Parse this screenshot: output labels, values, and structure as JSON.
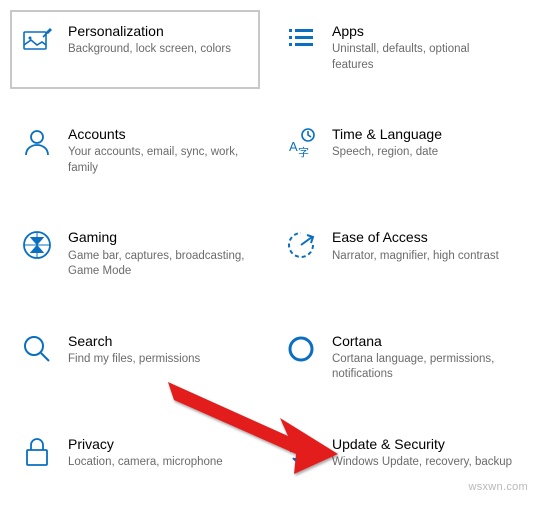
{
  "accent": "#0a6fc1",
  "arrow_color": "#e31b1b",
  "tiles": [
    {
      "id": "personalization",
      "title": "Personalization",
      "desc": "Background, lock screen, colors",
      "selected": true
    },
    {
      "id": "apps",
      "title": "Apps",
      "desc": "Uninstall, defaults, optional features",
      "selected": false
    },
    {
      "id": "accounts",
      "title": "Accounts",
      "desc": "Your accounts, email, sync, work, family",
      "selected": false
    },
    {
      "id": "time-language",
      "title": "Time & Language",
      "desc": "Speech, region, date",
      "selected": false
    },
    {
      "id": "gaming",
      "title": "Gaming",
      "desc": "Game bar, captures, broadcasting, Game Mode",
      "selected": false
    },
    {
      "id": "ease-of-access",
      "title": "Ease of Access",
      "desc": "Narrator, magnifier, high contrast",
      "selected": false
    },
    {
      "id": "search",
      "title": "Search",
      "desc": "Find my files, permissions",
      "selected": false
    },
    {
      "id": "cortana",
      "title": "Cortana",
      "desc": "Cortana language, permissions, notifications",
      "selected": false
    },
    {
      "id": "privacy",
      "title": "Privacy",
      "desc": "Location, camera, microphone",
      "selected": false
    },
    {
      "id": "update-security",
      "title": "Update & Security",
      "desc": "Windows Update, recovery, backup",
      "selected": false
    }
  ],
  "watermark": "wsxwn.com"
}
